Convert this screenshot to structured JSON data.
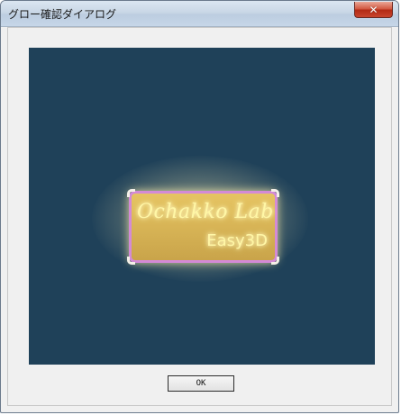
{
  "window": {
    "title": "グロー確認ダイアログ",
    "close_icon": "close-icon"
  },
  "preview": {
    "background_color": "#1f4159",
    "logo": {
      "line1": "Ochakko Lab",
      "line2": "Easy3D",
      "text_color": "#fff7a6",
      "border_color": "#d38ad6",
      "fill_color": "#d6b356"
    }
  },
  "buttons": {
    "ok_label": "OK"
  }
}
